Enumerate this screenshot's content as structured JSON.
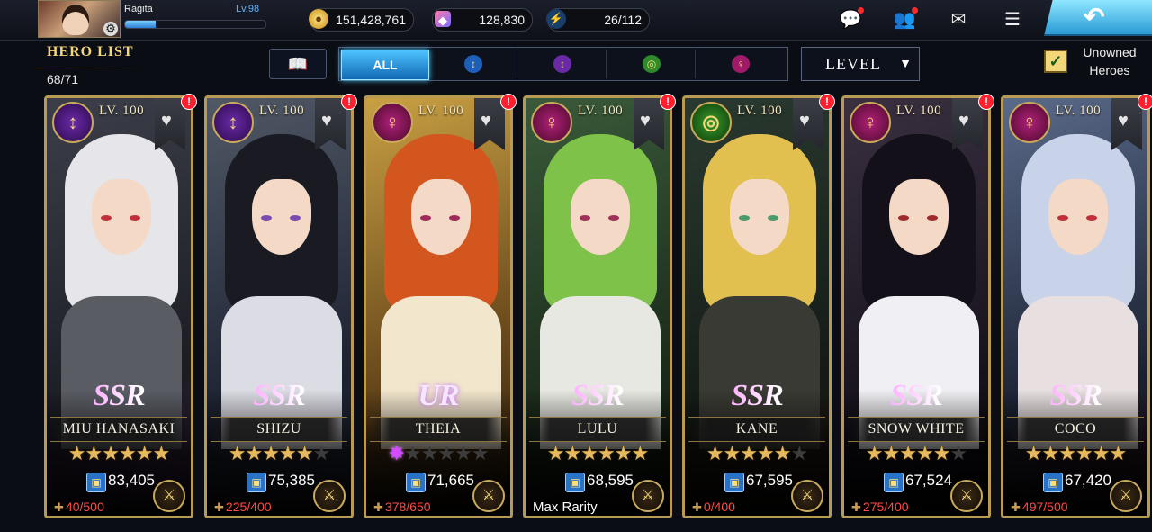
{
  "player": {
    "name": "Ragita",
    "level": "Lv.98",
    "exp_progress": 0.22
  },
  "resources": {
    "gold": "151,428,761",
    "gems": "128,830",
    "stamina": "26/112"
  },
  "top_icons": [
    "chat-icon",
    "friends-icon",
    "mail-icon",
    "menu-icon",
    "back-icon"
  ],
  "hero_list": {
    "title": "HERO LIST",
    "count": "68/71"
  },
  "filters": {
    "all_label": "ALL",
    "classes": [
      "blue-class-icon",
      "purple-class-icon",
      "green-class-icon",
      "magenta-class-icon"
    ],
    "sort_label": "LEVEL",
    "unowned_label": "Unowned Heroes",
    "unowned_checked": true
  },
  "heroes": [
    {
      "name": "MIU HANASAKI",
      "level": "LV. 100",
      "rarity": "SSR",
      "stars": 6,
      "star_style": "gold",
      "power": "83,405",
      "shards": "40/500",
      "status": "",
      "class_icon": "purple-class-icon"
    },
    {
      "name": "SHIZU",
      "level": "LV. 100",
      "rarity": "SSR",
      "stars": 5,
      "star_style": "gold",
      "power": "75,385",
      "shards": "225/400",
      "status": "",
      "class_icon": "purple-class-icon"
    },
    {
      "name": "THEIA",
      "level": "LV. 100",
      "rarity": "UR",
      "stars": 1,
      "star_style": "purple",
      "power": "71,665",
      "shards": "378/650",
      "status": "",
      "class_icon": "magenta-class-icon"
    },
    {
      "name": "LULU",
      "level": "LV. 100",
      "rarity": "SSR",
      "stars": 6,
      "star_style": "gold",
      "power": "68,595",
      "shards": "",
      "status": "Max Rarity",
      "class_icon": "magenta-class-icon"
    },
    {
      "name": "KANE",
      "level": "LV. 100",
      "rarity": "SSR",
      "stars": 5,
      "star_style": "gold",
      "power": "67,595",
      "shards": "0/400",
      "status": "",
      "class_icon": "green-class-icon"
    },
    {
      "name": "SNOW WHITE",
      "level": "LV. 100",
      "rarity": "SSR",
      "stars": 5,
      "star_style": "gold",
      "power": "67,524",
      "shards": "275/400",
      "status": "",
      "class_icon": "magenta-class-icon"
    },
    {
      "name": "COCO",
      "level": "LV. 100",
      "rarity": "SSR",
      "stars": 6,
      "star_style": "gold",
      "power": "67,420",
      "shards": "497/500",
      "status": "",
      "class_icon": "magenta-class-icon"
    }
  ],
  "colors": {
    "gold_frame": "#b89a52",
    "accent_blue": "#4ec3ff",
    "alert_red": "#ff1f2e",
    "shard_red": "#ff4a4a"
  }
}
